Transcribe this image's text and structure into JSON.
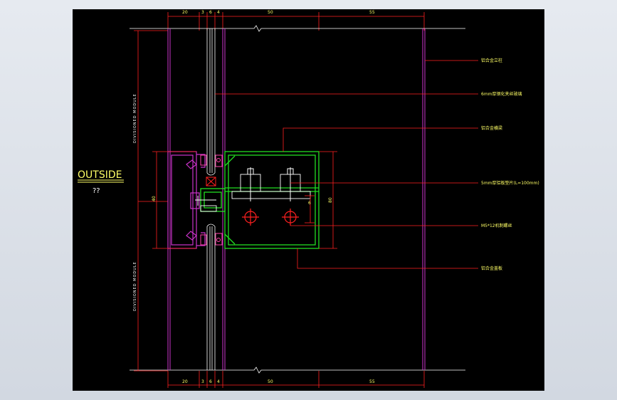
{
  "drawing": {
    "outside_label": "OUTSIDE",
    "outside_sub": "??",
    "top_dims": [
      "20",
      "3",
      "6",
      "4",
      "50",
      "55"
    ],
    "bottom_dims": [
      "20",
      "3",
      "6",
      "4",
      "50",
      "55"
    ],
    "vertical_text_upper": "DIVISIONED MODULE",
    "vertical_text_lower": "DIVISIONED MODULE",
    "callouts": [
      "铝合金立柱",
      "6mm厚钢化夹丝玻璃",
      "铝合金横梁",
      "5mm厚铝板垫片(L=100mm)",
      "M5*12机制螺丝",
      "铝合金盖板"
    ],
    "left_dim": "40",
    "right_dim": "80",
    "small_dim": "6"
  },
  "colors": {
    "background": "#000000",
    "dimension": "#ff2020",
    "mullion": "#cc33cc",
    "profile": "#22dd22",
    "glass": "#ffffff",
    "text": "#ffff66"
  }
}
